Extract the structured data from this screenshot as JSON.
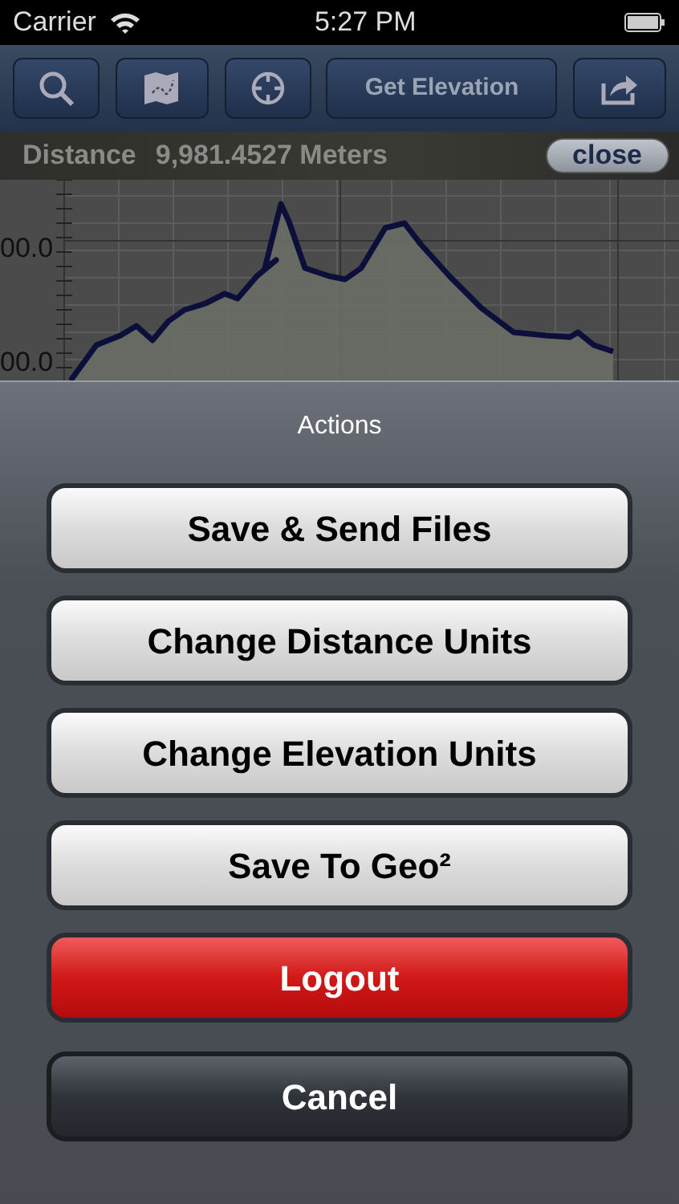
{
  "status_bar": {
    "carrier": "Carrier",
    "time": "5:27 PM"
  },
  "toolbar": {
    "items": [
      {
        "kind": "search"
      },
      {
        "kind": "map"
      },
      {
        "kind": "locate"
      },
      {
        "kind": "text",
        "label": "Get Elevation"
      },
      {
        "kind": "share"
      }
    ]
  },
  "distance_bar": {
    "label": "Distance",
    "value": "9,981.4527 Meters",
    "close": "close"
  },
  "chart": {
    "y_labels": [
      "00.0",
      "00.0"
    ]
  },
  "action_sheet": {
    "title": "Actions",
    "buttons": [
      {
        "label": "Save & Send Files",
        "kind": "default"
      },
      {
        "label": "Change Distance Units",
        "kind": "default"
      },
      {
        "label": "Change Elevation Units",
        "kind": "default"
      },
      {
        "label": "Save To Geo²",
        "kind": "default"
      },
      {
        "label": "Logout",
        "kind": "destructive"
      },
      {
        "label": "Cancel",
        "kind": "cancel"
      }
    ]
  }
}
